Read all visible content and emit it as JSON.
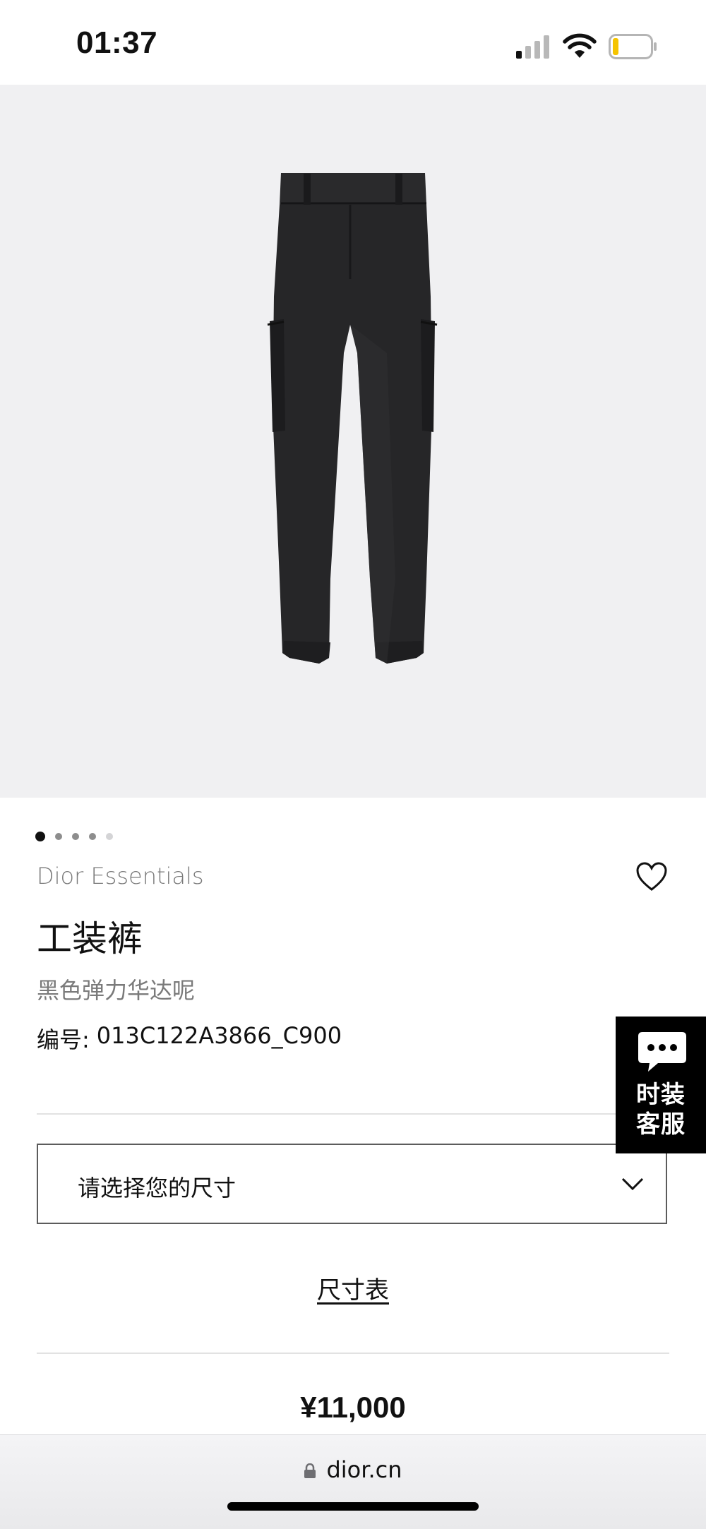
{
  "status_bar": {
    "time": "01:37",
    "battery_level": 0.15,
    "battery_color": "#f5c400"
  },
  "carousel": {
    "total": 5,
    "active_index": 0
  },
  "product": {
    "brand": "Dior Essentials",
    "title": "工装裤",
    "subtitle": "黑色弹力华达呢",
    "sku_label": "编号:",
    "sku_value": "013C122A3866_C900",
    "price": "¥11,000"
  },
  "size_select": {
    "placeholder": "请选择您的尺寸"
  },
  "size_chart_link": "尺寸表",
  "customer_service": {
    "label_line1": "时装",
    "label_line2": "客服"
  },
  "browser": {
    "url": "dior.cn"
  },
  "icons": {
    "favorite": "heart-outline-icon",
    "dropdown": "chevron-down-icon",
    "chat": "chat-bubble-icon",
    "lock": "lock-icon"
  }
}
